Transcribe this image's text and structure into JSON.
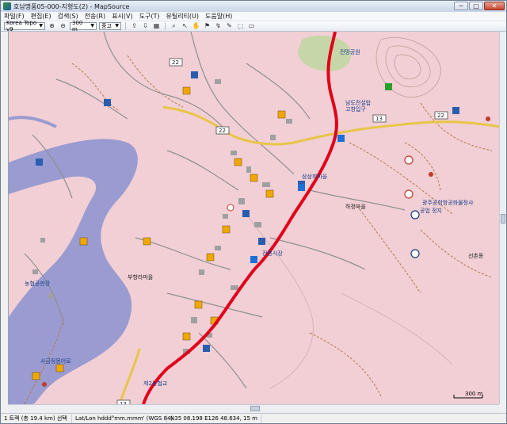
{
  "window": {
    "title": "호남명품05-000-지형도(2) - MapSource",
    "controls": [
      "─",
      "□",
      "✕"
    ]
  },
  "menu": [
    "파일(F)",
    "편집(E)",
    "검색(S)",
    "전송(R)",
    "표시(V)",
    "도구(T)",
    "유틸리티(U)",
    "도움말(H)"
  ],
  "toolbar": {
    "map_select": "Korea Topo v9",
    "zoom_select": "300 m",
    "detail_select": "중고"
  },
  "map": {
    "labels": {
      "jeonmang": "전망공원",
      "jeonmang2": "남도전설탑",
      "tosang": "고창입구",
      "gwangju_bus": "광주공항항공화물정사",
      "bus_stop2": "공업 정지",
      "sangchon": "선촌동",
      "mid_label": "삼삼회마을",
      "mid_label2": "전통시장",
      "sw_label": "제2농협교",
      "left_label": "사금정몽어로",
      "left_label2": "부항라마을",
      "left_label3": "농협공판장",
      "east_label": "하정마을",
      "scale": "300 m",
      "road_22a": "22",
      "road_22b": "22",
      "road_22c": "22",
      "road_13a": "13",
      "road_13b": "13"
    }
  },
  "status": {
    "route": "1 트랙 (총 19.4 km) 선택",
    "format": "Lat/Lon hddd°mm.mmm' (WGS 84)",
    "coords": "N35 08.198 E126 48.634, 15 m"
  },
  "colors": {
    "land": "#f1cfd5",
    "water": "#9a9bd0",
    "track": "#e0001b",
    "park": "#c7d6a8"
  }
}
